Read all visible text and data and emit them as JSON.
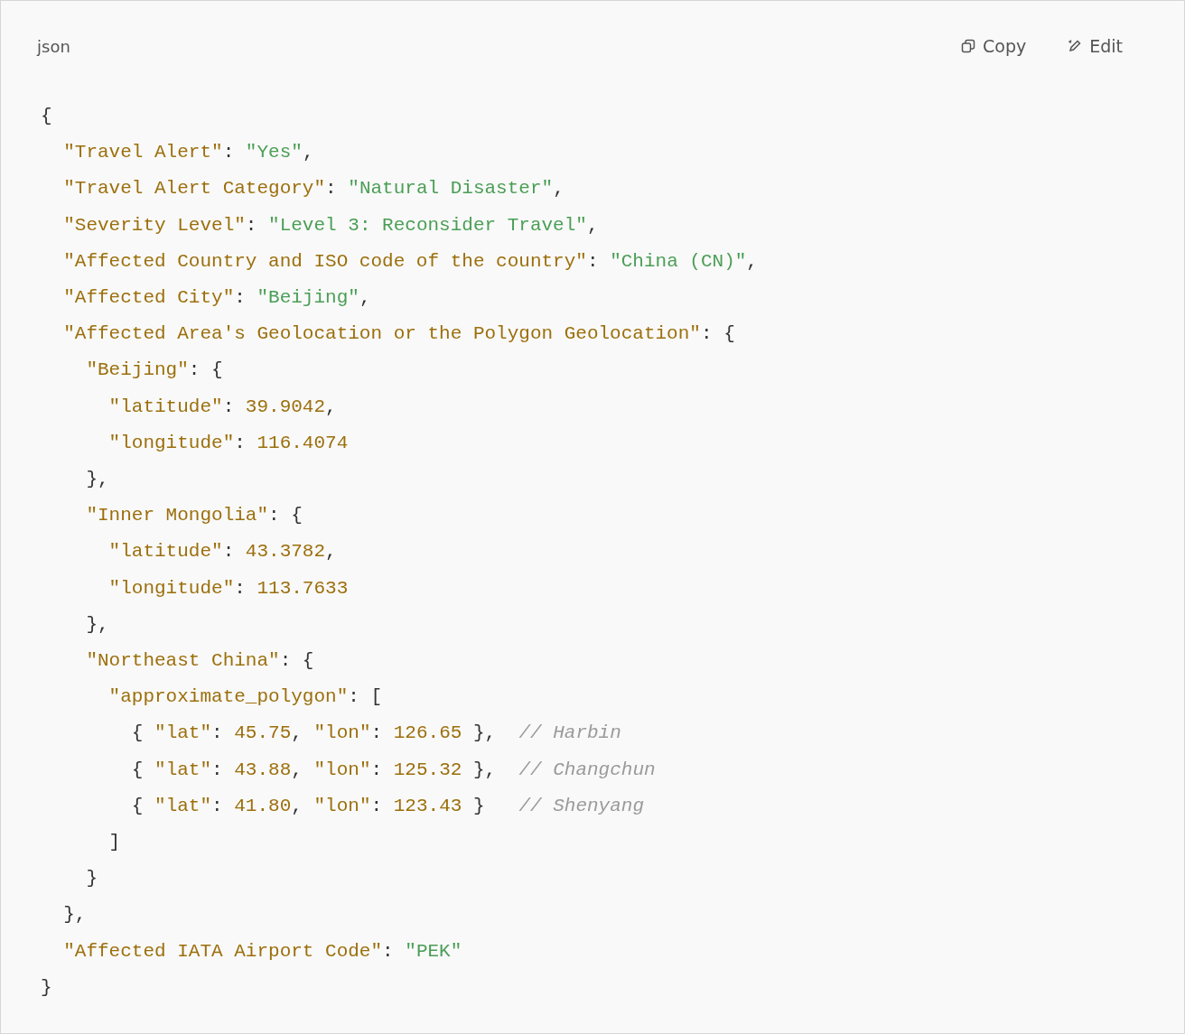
{
  "code_block": {
    "language": "json",
    "actions": [
      {
        "kind": "copy",
        "label": "Copy"
      },
      {
        "kind": "edit",
        "label": "Edit"
      }
    ],
    "lines": [
      {
        "tokens": [
          {
            "kind": "punct",
            "text": "{"
          }
        ],
        "children": [
          {
            "tokens": [
              {
                "kind": "key",
                "text": "\"Travel Alert\""
              },
              {
                "kind": "punct",
                "text": ": "
              },
              {
                "kind": "string",
                "text": "\"Yes\""
              },
              {
                "kind": "punct",
                "text": ","
              }
            ]
          },
          {
            "tokens": [
              {
                "kind": "key",
                "text": "\"Travel Alert Category\""
              },
              {
                "kind": "punct",
                "text": ": "
              },
              {
                "kind": "string",
                "text": "\"Natural Disaster\""
              },
              {
                "kind": "punct",
                "text": ","
              }
            ]
          },
          {
            "tokens": [
              {
                "kind": "key",
                "text": "\"Severity Level\""
              },
              {
                "kind": "punct",
                "text": ": "
              },
              {
                "kind": "string",
                "text": "\"Level 3: Reconsider Travel\""
              },
              {
                "kind": "punct",
                "text": ","
              }
            ]
          },
          {
            "tokens": [
              {
                "kind": "key",
                "text": "\"Affected Country and ISO code of the country\""
              },
              {
                "kind": "punct",
                "text": ": "
              },
              {
                "kind": "string",
                "text": "\"China (CN)\""
              },
              {
                "kind": "punct",
                "text": ","
              }
            ]
          },
          {
            "tokens": [
              {
                "kind": "key",
                "text": "\"Affected City\""
              },
              {
                "kind": "punct",
                "text": ": "
              },
              {
                "kind": "string",
                "text": "\"Beijing\""
              },
              {
                "kind": "punct",
                "text": ","
              }
            ]
          },
          {
            "tokens": [
              {
                "kind": "key",
                "text": "\"Affected Area's Geolocation or the Polygon Geolocation\""
              },
              {
                "kind": "punct",
                "text": ": {"
              }
            ],
            "children": [
              {
                "tokens": [
                  {
                    "kind": "key",
                    "text": "\"Beijing\""
                  },
                  {
                    "kind": "punct",
                    "text": ": {"
                  }
                ],
                "children": [
                  {
                    "tokens": [
                      {
                        "kind": "key",
                        "text": "\"latitude\""
                      },
                      {
                        "kind": "punct",
                        "text": ": "
                      },
                      {
                        "kind": "number",
                        "text": "39.9042"
                      },
                      {
                        "kind": "punct",
                        "text": ","
                      }
                    ]
                  },
                  {
                    "tokens": [
                      {
                        "kind": "key",
                        "text": "\"longitude\""
                      },
                      {
                        "kind": "punct",
                        "text": ": "
                      },
                      {
                        "kind": "number",
                        "text": "116.4074"
                      }
                    ]
                  }
                ]
              },
              {
                "tokens": [
                  {
                    "kind": "punct",
                    "text": "},"
                  }
                ]
              },
              {
                "tokens": [
                  {
                    "kind": "key",
                    "text": "\"Inner Mongolia\""
                  },
                  {
                    "kind": "punct",
                    "text": ": {"
                  }
                ],
                "children": [
                  {
                    "tokens": [
                      {
                        "kind": "key",
                        "text": "\"latitude\""
                      },
                      {
                        "kind": "punct",
                        "text": ": "
                      },
                      {
                        "kind": "number",
                        "text": "43.3782"
                      },
                      {
                        "kind": "punct",
                        "text": ","
                      }
                    ]
                  },
                  {
                    "tokens": [
                      {
                        "kind": "key",
                        "text": "\"longitude\""
                      },
                      {
                        "kind": "punct",
                        "text": ": "
                      },
                      {
                        "kind": "number",
                        "text": "113.7633"
                      }
                    ]
                  }
                ]
              },
              {
                "tokens": [
                  {
                    "kind": "punct",
                    "text": "},"
                  }
                ]
              },
              {
                "tokens": [
                  {
                    "kind": "key",
                    "text": "\"Northeast China\""
                  },
                  {
                    "kind": "punct",
                    "text": ": {"
                  }
                ],
                "children": [
                  {
                    "tokens": [
                      {
                        "kind": "key",
                        "text": "\"approximate_polygon\""
                      },
                      {
                        "kind": "punct",
                        "text": ": ["
                      }
                    ],
                    "children": [
                      {
                        "tokens": [
                          {
                            "kind": "punct",
                            "text": "{ "
                          },
                          {
                            "kind": "key",
                            "text": "\"lat\""
                          },
                          {
                            "kind": "punct",
                            "text": ": "
                          },
                          {
                            "kind": "number",
                            "text": "45.75"
                          },
                          {
                            "kind": "punct",
                            "text": ", "
                          },
                          {
                            "kind": "key",
                            "text": "\"lon\""
                          },
                          {
                            "kind": "punct",
                            "text": ": "
                          },
                          {
                            "kind": "number",
                            "text": "126.65"
                          },
                          {
                            "kind": "punct",
                            "text": " },  "
                          },
                          {
                            "kind": "comment",
                            "text": "// Harbin"
                          }
                        ]
                      },
                      {
                        "tokens": [
                          {
                            "kind": "punct",
                            "text": "{ "
                          },
                          {
                            "kind": "key",
                            "text": "\"lat\""
                          },
                          {
                            "kind": "punct",
                            "text": ": "
                          },
                          {
                            "kind": "number",
                            "text": "43.88"
                          },
                          {
                            "kind": "punct",
                            "text": ", "
                          },
                          {
                            "kind": "key",
                            "text": "\"lon\""
                          },
                          {
                            "kind": "punct",
                            "text": ": "
                          },
                          {
                            "kind": "number",
                            "text": "125.32"
                          },
                          {
                            "kind": "punct",
                            "text": " },  "
                          },
                          {
                            "kind": "comment",
                            "text": "// Changchun"
                          }
                        ]
                      },
                      {
                        "tokens": [
                          {
                            "kind": "punct",
                            "text": "{ "
                          },
                          {
                            "kind": "key",
                            "text": "\"lat\""
                          },
                          {
                            "kind": "punct",
                            "text": ": "
                          },
                          {
                            "kind": "number",
                            "text": "41.80"
                          },
                          {
                            "kind": "punct",
                            "text": ", "
                          },
                          {
                            "kind": "key",
                            "text": "\"lon\""
                          },
                          {
                            "kind": "punct",
                            "text": ": "
                          },
                          {
                            "kind": "number",
                            "text": "123.43"
                          },
                          {
                            "kind": "punct",
                            "text": " }   "
                          },
                          {
                            "kind": "comment",
                            "text": "// Shenyang"
                          }
                        ]
                      }
                    ]
                  },
                  {
                    "tokens": [
                      {
                        "kind": "punct",
                        "text": "]"
                      }
                    ]
                  }
                ]
              },
              {
                "tokens": [
                  {
                    "kind": "punct",
                    "text": "}"
                  }
                ]
              }
            ]
          },
          {
            "tokens": [
              {
                "kind": "punct",
                "text": "},"
              }
            ]
          },
          {
            "tokens": [
              {
                "kind": "key",
                "text": "\"Affected IATA Airport Code\""
              },
              {
                "kind": "punct",
                "text": ": "
              },
              {
                "kind": "string",
                "text": "\"PEK\""
              }
            ]
          }
        ]
      },
      {
        "tokens": [
          {
            "kind": "punct",
            "text": "}"
          }
        ]
      }
    ]
  }
}
